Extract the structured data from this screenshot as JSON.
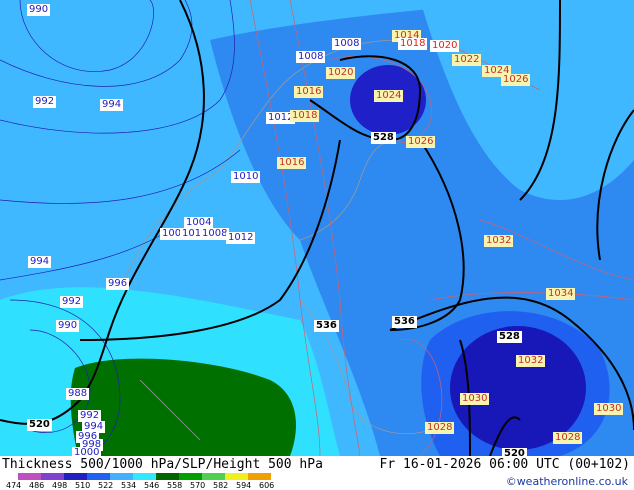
{
  "title": "Thickness 500/1000 hPa/SLP/Height 500 hPa",
  "datetime": "Fr 16-01-2026 06:00 UTC (00+102)",
  "credit": "©weatheronline.co.uk",
  "legend": {
    "ticks": [
      "474",
      "486",
      "498",
      "510",
      "522",
      "534",
      "546",
      "558",
      "570",
      "582",
      "594",
      "606"
    ],
    "colors": [
      "#c050c0",
      "#8040d0",
      "#2020c0",
      "#2060f0",
      "#40b0ff",
      "#30e8ff",
      "#006400",
      "#00a000",
      "#50d050",
      "#f0f020",
      "#f0a000"
    ]
  },
  "map_labels": {
    "slp_low": [
      "990",
      "992",
      "994",
      "994",
      "992",
      "990",
      "996",
      "988",
      "992",
      "994",
      "996",
      "998",
      "1000",
      "1008",
      "1012",
      "1008",
      "1010",
      "1004",
      "1001",
      "1010",
      "1008",
      "1012"
    ],
    "slp_high": [
      "1014",
      "1016",
      "1018",
      "1020",
      "1022",
      "1024",
      "1024",
      "1026",
      "1026",
      "1032",
      "1034",
      "1032",
      "1030",
      "1030",
      "1028",
      "1028",
      "1016",
      "1018",
      "1020"
    ],
    "thickness": [
      "528",
      "536",
      "536",
      "528",
      "520",
      "520"
    ]
  }
}
